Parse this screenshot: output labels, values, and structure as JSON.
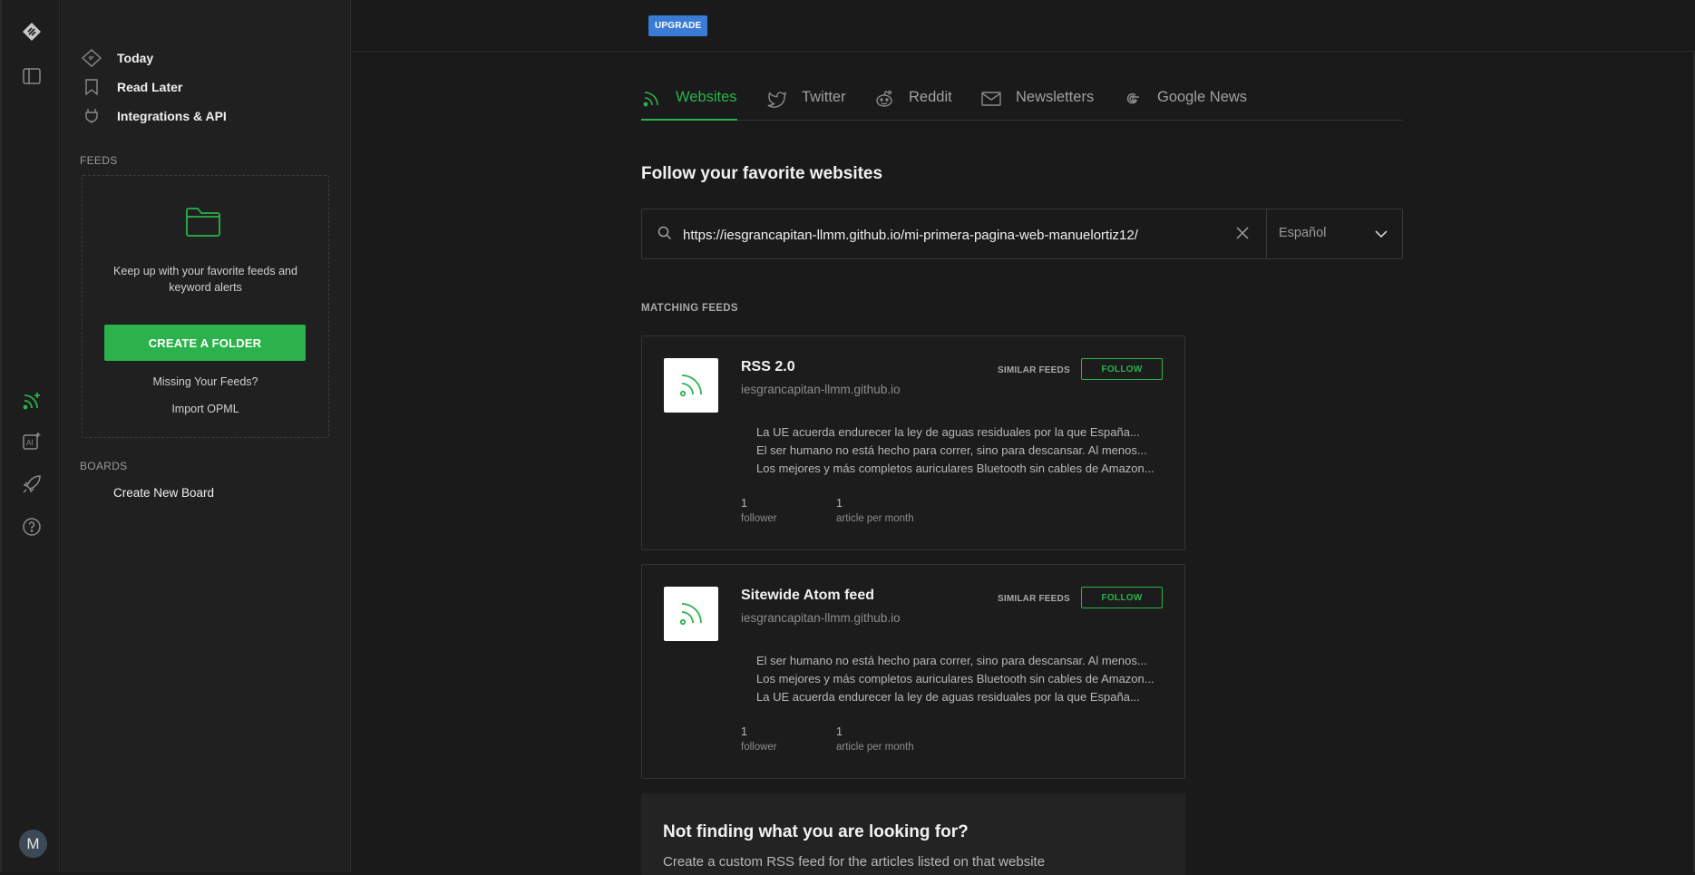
{
  "app": {
    "upgrade_label": "UPGRADE",
    "avatar_initial": "M"
  },
  "rail": {
    "icons": [
      "feedly-logo-icon",
      "sidebar-toggle-icon",
      "add-feed-icon",
      "ai-feed-icon",
      "rocket-icon",
      "help-icon"
    ]
  },
  "sidebar": {
    "nav": [
      {
        "label": "Today",
        "icon": "today-icon"
      },
      {
        "label": "Read Later",
        "icon": "bookmark-icon"
      },
      {
        "label": "Integrations & API",
        "icon": "plug-icon"
      }
    ],
    "feeds_label": "FEEDS",
    "feeds_empty_text": "Keep up with your favorite feeds and keyword alerts",
    "create_folder_label": "CREATE A FOLDER",
    "missing_feeds_label": "Missing Your Feeds?",
    "import_opml_label": "Import OPML",
    "boards_label": "BOARDS",
    "create_board_label": "Create New Board"
  },
  "tabs": [
    {
      "label": "Websites",
      "icon": "rss-icon",
      "active": true
    },
    {
      "label": "Twitter",
      "icon": "twitter-icon",
      "active": false
    },
    {
      "label": "Reddit",
      "icon": "reddit-icon",
      "active": false
    },
    {
      "label": "Newsletters",
      "icon": "mail-icon",
      "active": false
    },
    {
      "label": "Google News",
      "icon": "google-icon",
      "active": false
    }
  ],
  "main": {
    "heading": "Follow your favorite websites",
    "search_value": "https://iesgrancapitan-llmm.github.io/mi-primera-pagina-web-manuelortiz12/",
    "language": "Español",
    "matching_label": "MATCHING FEEDS",
    "similar_label": "SIMILAR FEEDS",
    "follow_label": "FOLLOW",
    "feeds": [
      {
        "title": "RSS 2.0",
        "domain": "iesgrancapitan-llmm.github.io",
        "articles": [
          "La UE acuerda endurecer la ley de aguas residuales por la que España...",
          "El ser humano no está hecho para correr, sino para descansar. Al menos...",
          "Los mejores y más completos auriculares Bluetooth sin cables de Amazon..."
        ],
        "followers": "1",
        "followers_caption": "follower",
        "per_month": "1",
        "per_month_caption": "article per month"
      },
      {
        "title": "Sitewide Atom feed",
        "domain": "iesgrancapitan-llmm.github.io",
        "articles": [
          "El ser humano no está hecho para correr, sino para descansar. Al menos...",
          "Los mejores y más completos auriculares Bluetooth sin cables de Amazon...",
          "La UE acuerda endurecer la ley de aguas residuales por la que España..."
        ],
        "followers": "1",
        "followers_caption": "follower",
        "per_month": "1",
        "per_month_caption": "article per month"
      }
    ],
    "not_finding_title": "Not finding what you are looking for?",
    "not_finding_desc": "Create a custom RSS feed for the articles listed on that website"
  },
  "colors": {
    "accent": "#2bb24c",
    "upgrade": "#3a7bd5",
    "background": "#1a1a1a",
    "sidebar": "#202020"
  }
}
